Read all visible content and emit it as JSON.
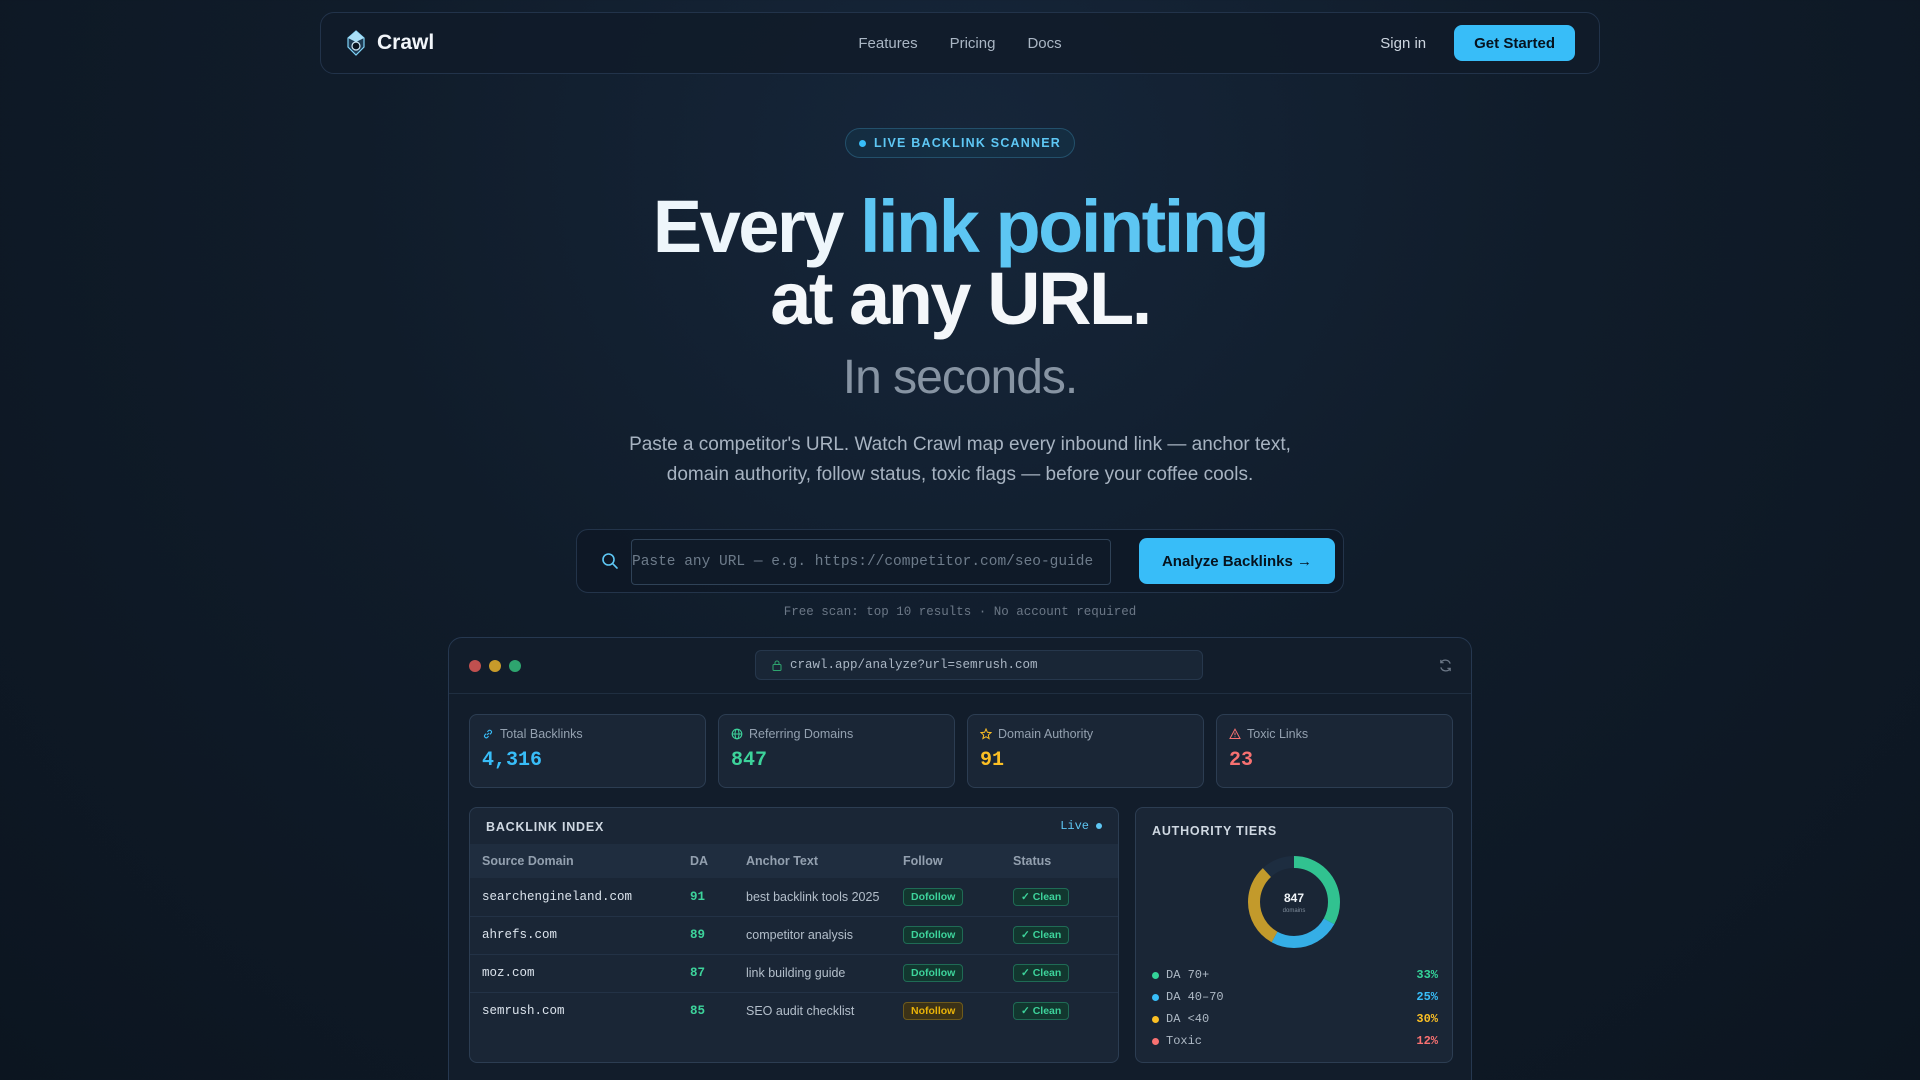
{
  "nav": {
    "brand": "Crawl",
    "links": [
      "Features",
      "Pricing",
      "Docs"
    ],
    "signin": "Sign in",
    "cta": "Get Started"
  },
  "hero": {
    "badge": "LIVE BACKLINK SCANNER",
    "title_line1_word1": "Every",
    "title_line1_accent": "link pointing",
    "title_line2": "at any URL.",
    "subtitle": "In seconds.",
    "description_line1": "Paste a competitor's URL. Watch Crawl map every inbound link — anchor text,",
    "description_line2": "domain authority, follow status, toxic flags — before your coffee cools."
  },
  "search": {
    "placeholder": "Paste any URL — e.g. https://competitor.com/seo-guide",
    "button": "Analyze Backlinks →",
    "note": "Free scan: top 10 results · No account required"
  },
  "window": {
    "url": "crawl.app/analyze?url=semrush.com",
    "stats": [
      {
        "label": "Total Backlinks",
        "value": "4,316",
        "color": "#38bdf8",
        "icon": "link-icon"
      },
      {
        "label": "Referring Domains",
        "value": "847",
        "color": "#3dd39b",
        "icon": "globe-icon"
      },
      {
        "label": "Domain Authority",
        "value": "91",
        "color": "#fbbf24",
        "icon": "star-icon"
      },
      {
        "label": "Toxic Links",
        "value": "23",
        "color": "#f87171",
        "icon": "warning-icon"
      }
    ],
    "index": {
      "title": "BACKLINK INDEX",
      "live": "Live",
      "columns": [
        "Source Domain",
        "DA",
        "Anchor Text",
        "Follow",
        "Status"
      ],
      "rows": [
        {
          "domain": "searchengineland.com",
          "da": "91",
          "anchor": "best backlink tools 2025",
          "follow": "Dofollow",
          "status": "✓ Clean"
        },
        {
          "domain": "ahrefs.com",
          "da": "89",
          "anchor": "competitor analysis",
          "follow": "Dofollow",
          "status": "✓ Clean"
        },
        {
          "domain": "moz.com",
          "da": "87",
          "anchor": "link building guide",
          "follow": "Dofollow",
          "status": "✓ Clean"
        },
        {
          "domain": "semrush.com",
          "da": "85",
          "anchor": "SEO audit checklist",
          "follow": "Nofollow",
          "status": "✓ Clean"
        }
      ]
    },
    "tiers": {
      "title": "AUTHORITY TIERS",
      "center_value": "847",
      "center_label": "domains",
      "items": [
        {
          "label": "DA 70+",
          "pct": "33%",
          "value": 33,
          "color": "#34d399"
        },
        {
          "label": "DA 40–70",
          "pct": "25%",
          "value": 25,
          "color": "#38bdf8"
        },
        {
          "label": "DA <40",
          "pct": "30%",
          "value": 30,
          "color": "#fbbf24"
        },
        {
          "label": "Toxic",
          "pct": "12%",
          "value": 12,
          "color": "#f87171"
        }
      ]
    }
  }
}
